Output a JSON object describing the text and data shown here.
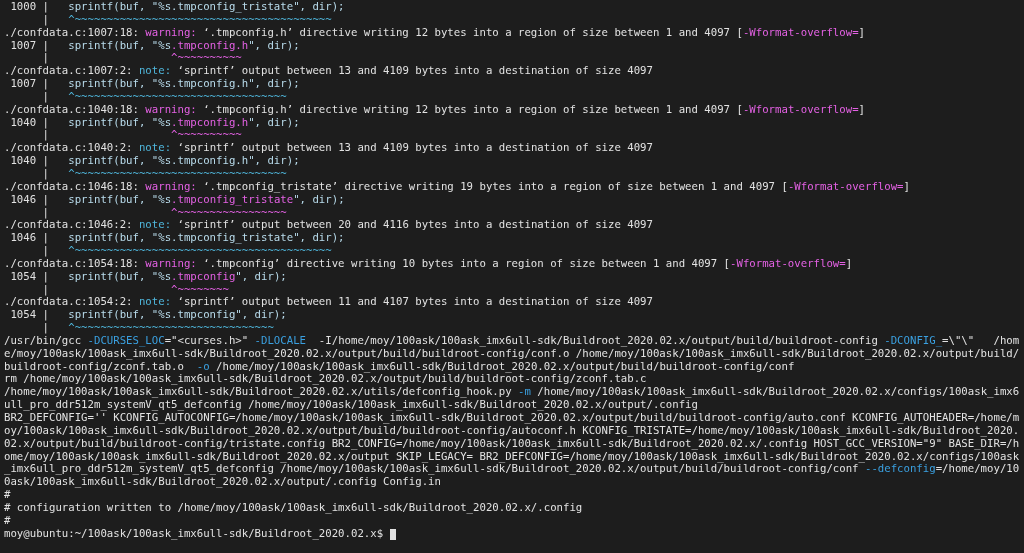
{
  "terminal": {
    "lines": [
      {
        "kind": "source",
        "parts": [
          {
            "kind": "text",
            "text": " 1000 |   "
          },
          {
            "kind": "code",
            "text": "sprintf(buf, \"%s.tmpconfig_tristate\", dir);"
          }
        ]
      },
      {
        "kind": "caret",
        "parts": [
          {
            "kind": "text",
            "text": "      |   "
          },
          {
            "kind": "note",
            "text": "^~~~~~~~~~~~~~~~~~~~~~~~~~~~~~~~~~~~~~~~~"
          }
        ]
      },
      {
        "kind": "diagnostic",
        "parts": [
          {
            "kind": "text",
            "text": "./confdata.c:1007:18: "
          },
          {
            "kind": "warn",
            "text": "warning:"
          },
          {
            "kind": "text",
            "text": " ‘.tmpconfig.h’ directive writing 12 bytes into a region of size between 1 and 4097 ["
          },
          {
            "kind": "warn",
            "text": "-Wformat-overflow="
          },
          {
            "kind": "text",
            "text": "]"
          }
        ]
      },
      {
        "kind": "source",
        "parts": [
          {
            "kind": "text",
            "text": " 1007 |   "
          },
          {
            "kind": "code",
            "text": "sprintf(buf, \"%s"
          },
          {
            "kind": "warn",
            "text": ".tmpconfig.h"
          },
          {
            "kind": "code",
            "text": "\", dir);"
          }
        ]
      },
      {
        "kind": "caret",
        "parts": [
          {
            "kind": "text",
            "text": "      |                   "
          },
          {
            "kind": "warn",
            "text": "^~~~~~~~~~~"
          }
        ]
      },
      {
        "kind": "diagnostic",
        "parts": [
          {
            "kind": "text",
            "text": "./confdata.c:1007:2: "
          },
          {
            "kind": "note",
            "text": "note:"
          },
          {
            "kind": "text",
            "text": " ‘sprintf’ output between 13 and 4109 bytes into a destination of size 4097"
          }
        ]
      },
      {
        "kind": "source",
        "parts": [
          {
            "kind": "text",
            "text": " 1007 |   "
          },
          {
            "kind": "code",
            "text": "sprintf(buf, \"%s.tmpconfig.h\", dir);"
          }
        ]
      },
      {
        "kind": "caret",
        "parts": [
          {
            "kind": "text",
            "text": "      |   "
          },
          {
            "kind": "note",
            "text": "^~~~~~~~~~~~~~~~~~~~~~~~~~~~~~~~~~"
          }
        ]
      },
      {
        "kind": "diagnostic",
        "parts": [
          {
            "kind": "text",
            "text": "./confdata.c:1040:18: "
          },
          {
            "kind": "warn",
            "text": "warning:"
          },
          {
            "kind": "text",
            "text": " ‘.tmpconfig.h’ directive writing 12 bytes into a region of size between 1 and 4097 ["
          },
          {
            "kind": "warn",
            "text": "-Wformat-overflow="
          },
          {
            "kind": "text",
            "text": "]"
          }
        ]
      },
      {
        "kind": "source",
        "parts": [
          {
            "kind": "text",
            "text": " 1040 |   "
          },
          {
            "kind": "code",
            "text": "sprintf(buf, \"%s"
          },
          {
            "kind": "warn",
            "text": ".tmpconfig.h"
          },
          {
            "kind": "code",
            "text": "\", dir);"
          }
        ]
      },
      {
        "kind": "caret",
        "parts": [
          {
            "kind": "text",
            "text": "      |                   "
          },
          {
            "kind": "warn",
            "text": "^~~~~~~~~~~"
          }
        ]
      },
      {
        "kind": "diagnostic",
        "parts": [
          {
            "kind": "text",
            "text": "./confdata.c:1040:2: "
          },
          {
            "kind": "note",
            "text": "note:"
          },
          {
            "kind": "text",
            "text": " ‘sprintf’ output between 13 and 4109 bytes into a destination of size 4097"
          }
        ]
      },
      {
        "kind": "source",
        "parts": [
          {
            "kind": "text",
            "text": " 1040 |   "
          },
          {
            "kind": "code",
            "text": "sprintf(buf, \"%s.tmpconfig.h\", dir);"
          }
        ]
      },
      {
        "kind": "caret",
        "parts": [
          {
            "kind": "text",
            "text": "      |   "
          },
          {
            "kind": "note",
            "text": "^~~~~~~~~~~~~~~~~~~~~~~~~~~~~~~~~~"
          }
        ]
      },
      {
        "kind": "diagnostic",
        "parts": [
          {
            "kind": "text",
            "text": "./confdata.c:1046:18: "
          },
          {
            "kind": "warn",
            "text": "warning:"
          },
          {
            "kind": "text",
            "text": " ‘.tmpconfig_tristate’ directive writing 19 bytes into a region of size between 1 and 4097 ["
          },
          {
            "kind": "warn",
            "text": "-Wformat-overflow="
          },
          {
            "kind": "text",
            "text": "]"
          }
        ]
      },
      {
        "kind": "source",
        "parts": [
          {
            "kind": "text",
            "text": " 1046 |   "
          },
          {
            "kind": "code",
            "text": "sprintf(buf, \"%s"
          },
          {
            "kind": "warn",
            "text": ".tmpconfig_tristate"
          },
          {
            "kind": "code",
            "text": "\", dir);"
          }
        ]
      },
      {
        "kind": "caret",
        "parts": [
          {
            "kind": "text",
            "text": "      |                   "
          },
          {
            "kind": "warn",
            "text": "^~~~~~~~~~~~~~~~~~"
          }
        ]
      },
      {
        "kind": "diagnostic",
        "parts": [
          {
            "kind": "text",
            "text": "./confdata.c:1046:2: "
          },
          {
            "kind": "note",
            "text": "note:"
          },
          {
            "kind": "text",
            "text": " ‘sprintf’ output between 20 and 4116 bytes into a destination of size 4097"
          }
        ]
      },
      {
        "kind": "source",
        "parts": [
          {
            "kind": "text",
            "text": " 1046 |   "
          },
          {
            "kind": "code",
            "text": "sprintf(buf, \"%s.tmpconfig_tristate\", dir);"
          }
        ]
      },
      {
        "kind": "caret",
        "parts": [
          {
            "kind": "text",
            "text": "      |   "
          },
          {
            "kind": "note",
            "text": "^~~~~~~~~~~~~~~~~~~~~~~~~~~~~~~~~~~~~~~~~"
          }
        ]
      },
      {
        "kind": "diagnostic",
        "parts": [
          {
            "kind": "text",
            "text": "./confdata.c:1054:18: "
          },
          {
            "kind": "warn",
            "text": "warning:"
          },
          {
            "kind": "text",
            "text": " ‘.tmpconfig’ directive writing 10 bytes into a region of size between 1 and 4097 ["
          },
          {
            "kind": "warn",
            "text": "-Wformat-overflow="
          },
          {
            "kind": "text",
            "text": "]"
          }
        ]
      },
      {
        "kind": "source",
        "parts": [
          {
            "kind": "text",
            "text": " 1054 |   "
          },
          {
            "kind": "code",
            "text": "sprintf(buf, \"%s"
          },
          {
            "kind": "warn",
            "text": ".tmpconfig"
          },
          {
            "kind": "code",
            "text": "\", dir);"
          }
        ]
      },
      {
        "kind": "caret",
        "parts": [
          {
            "kind": "text",
            "text": "      |                   "
          },
          {
            "kind": "warn",
            "text": "^~~~~~~~~"
          }
        ]
      },
      {
        "kind": "diagnostic",
        "parts": [
          {
            "kind": "text",
            "text": "./confdata.c:1054:2: "
          },
          {
            "kind": "note",
            "text": "note:"
          },
          {
            "kind": "text",
            "text": " ‘sprintf’ output between 11 and 4107 bytes into a destination of size 4097"
          }
        ]
      },
      {
        "kind": "source",
        "parts": [
          {
            "kind": "text",
            "text": " 1054 |   "
          },
          {
            "kind": "code",
            "text": "sprintf(buf, \"%s.tmpconfig\", dir);"
          }
        ]
      },
      {
        "kind": "caret",
        "parts": [
          {
            "kind": "text",
            "text": "      |   "
          },
          {
            "kind": "note",
            "text": "^~~~~~~~~~~~~~~~~~~~~~~~~~~~~~~~"
          }
        ]
      },
      {
        "kind": "output",
        "parts": [
          {
            "kind": "text",
            "text": "/usr/bin/gcc "
          },
          {
            "kind": "flag",
            "text": "-DCURSES_LOC"
          },
          {
            "kind": "text",
            "text": "=\"<curses.h>\" "
          },
          {
            "kind": "flag",
            "text": "-DLOCALE"
          },
          {
            "kind": "text",
            "text": "  -I/home/moy/100ask/100ask_imx6ull-sdk/Buildroot_2020.02.x/output/build/buildroot-config "
          },
          {
            "kind": "flag",
            "text": "-DCONFIG_"
          },
          {
            "kind": "text",
            "text": "=\\\"\\\"   /hom"
          }
        ]
      },
      {
        "kind": "output",
        "parts": [
          {
            "kind": "text",
            "text": "e/moy/100ask/100ask_imx6ull-sdk/Buildroot_2020.02.x/output/build/buildroot-config/conf.o /home/moy/100ask/100ask_imx6ull-sdk/Buildroot_2020.02.x/output/build/"
          }
        ]
      },
      {
        "kind": "output",
        "parts": [
          {
            "kind": "text",
            "text": "buildroot-config/zconf.tab.o  "
          },
          {
            "kind": "flag",
            "text": "-o"
          },
          {
            "kind": "text",
            "text": " /home/moy/100ask/100ask_imx6ull-sdk/Buildroot_2020.02.x/output/build/buildroot-config/conf"
          }
        ]
      },
      {
        "kind": "output",
        "parts": [
          {
            "kind": "text",
            "text": "rm /home/moy/100ask/100ask_imx6ull-sdk/Buildroot_2020.02.x/output/build/buildroot-config/zconf.tab.c"
          }
        ]
      },
      {
        "kind": "output",
        "parts": [
          {
            "kind": "text",
            "text": "/home/moy/100ask/100ask_imx6ull-sdk/Buildroot_2020.02.x/utils/defconfig_hook.py "
          },
          {
            "kind": "flag",
            "text": "-m"
          },
          {
            "kind": "text",
            "text": " /home/moy/100ask/100ask_imx6ull-sdk/Buildroot_2020.02.x/configs/100ask_imx6"
          }
        ]
      },
      {
        "kind": "output",
        "parts": [
          {
            "kind": "text",
            "text": "ull_pro_ddr512m_systemV_qt5_defconfig /home/moy/100ask/100ask_imx6ull-sdk/Buildroot_2020.02.x/output/.config"
          }
        ]
      },
      {
        "kind": "output",
        "parts": [
          {
            "kind": "text",
            "text": "BR2_DEFCONFIG='' KCONFIG_AUTOCONFIG=/home/moy/100ask/100ask_imx6ull-sdk/Buildroot_2020.02.x/output/build/buildroot-config/auto.conf KCONFIG_AUTOHEADER=/home/m"
          }
        ]
      },
      {
        "kind": "output",
        "parts": [
          {
            "kind": "text",
            "text": "oy/100ask/100ask_imx6ull-sdk/Buildroot_2020.02.x/output/build/buildroot-config/autoconf.h KCONFIG_TRISTATE=/home/moy/100ask/100ask_imx6ull-sdk/Buildroot_2020."
          }
        ]
      },
      {
        "kind": "output",
        "parts": [
          {
            "kind": "text",
            "text": "02.x/output/build/buildroot-config/tristate.config BR2_CONFIG=/home/moy/100ask/100ask_imx6ull-sdk/Buildroot_2020.02.x/.config HOST_GCC_VERSION=\"9\" BASE_DIR=/h"
          }
        ]
      },
      {
        "kind": "output",
        "parts": [
          {
            "kind": "text",
            "text": "ome/moy/100ask/100ask_imx6ull-sdk/Buildroot_2020.02.x/output SKIP_LEGACY= BR2_DEFCONFIG=/home/moy/100ask/100ask_imx6ull-sdk/Buildroot_2020.02.x/configs/100ask"
          }
        ]
      },
      {
        "kind": "output",
        "parts": [
          {
            "kind": "text",
            "text": "_imx6ull_pro_ddr512m_systemV_qt5_defconfig /home/moy/100ask/100ask_imx6ull-sdk/Buildroot_2020.02.x/output/build/buildroot-config/conf "
          },
          {
            "kind": "flag",
            "text": "--defconfig"
          },
          {
            "kind": "text",
            "text": "=/home/moy/10"
          }
        ]
      },
      {
        "kind": "output",
        "parts": [
          {
            "kind": "text",
            "text": "0ask/100ask_imx6ull-sdk/Buildroot_2020.02.x/output/.config Config.in"
          }
        ]
      },
      {
        "kind": "output",
        "parts": [
          {
            "kind": "text",
            "text": "#"
          }
        ]
      },
      {
        "kind": "output",
        "parts": [
          {
            "kind": "text",
            "text": "# configuration written to /home/moy/100ask/100ask_imx6ull-sdk/Buildroot_2020.02.x/.config"
          }
        ]
      },
      {
        "kind": "output",
        "parts": [
          {
            "kind": "text",
            "text": "#"
          }
        ]
      },
      {
        "kind": "prompt",
        "cursor": true,
        "parts": [
          {
            "kind": "text",
            "text": "moy@ubuntu:~/100ask/100ask_imx6ull-sdk/Buildroot_2020.02.x$ "
          }
        ]
      }
    ]
  }
}
